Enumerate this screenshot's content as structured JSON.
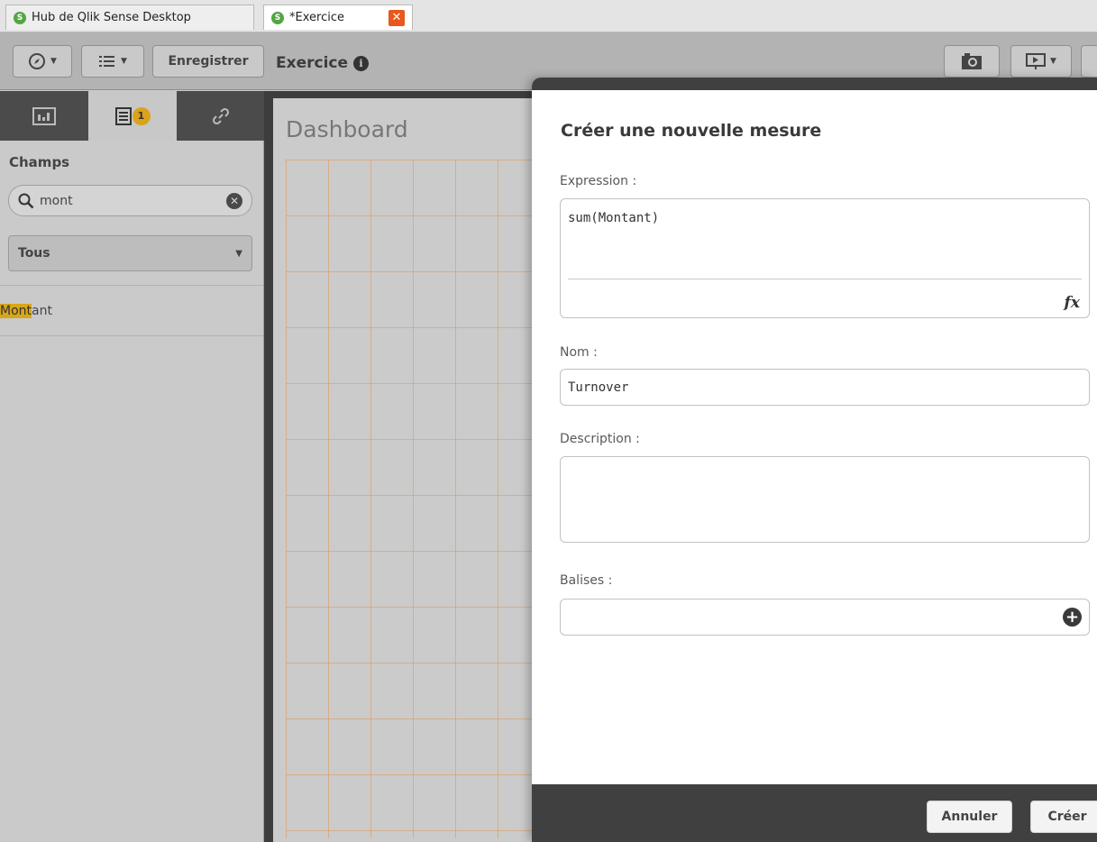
{
  "browser_tabs": [
    {
      "label": "Hub de Qlik Sense Desktop",
      "logo": "S"
    },
    {
      "label": "*Exercice",
      "logo": "S",
      "close": "✕"
    }
  ],
  "toolbar": {
    "navigation_icon": "compass-icon",
    "list_icon": "list-icon",
    "save_label": "Enregistrer",
    "app_title": "Exercice",
    "info_glyph": "i",
    "snapshot_icon": "camera-icon",
    "present_icon": "presentation-icon"
  },
  "assets_panel": {
    "tabs": [
      "charts-icon",
      "fields-icon",
      "link-icon"
    ],
    "fields_badge": "1",
    "section_title": "Champs",
    "search": {
      "value": "mont",
      "clear_icon": "clear-icon"
    },
    "filter": {
      "selected": "Tous"
    },
    "results": [
      {
        "match": "Mont",
        "rest": "ant"
      }
    ]
  },
  "sheet": {
    "title": "Dashboard"
  },
  "modal": {
    "title": "Créer une nouvelle mesure",
    "expression_label": "Expression :",
    "expression_value": "sum(Montant)",
    "fx_label": "fx",
    "name_label": "Nom :",
    "name_value": "Turnover",
    "description_label": "Description :",
    "description_value": "",
    "tags_label": "Balises :",
    "tags_value": "",
    "add_glyph": "+",
    "cancel_label": "Annuler",
    "create_label": "Créer"
  },
  "colors": {
    "accent_yellow": "#d7a719",
    "tab_close_orange": "#e8581b",
    "qlik_green": "#54a543",
    "dark_chrome": "#404040",
    "grid_orange": "#e09650"
  }
}
